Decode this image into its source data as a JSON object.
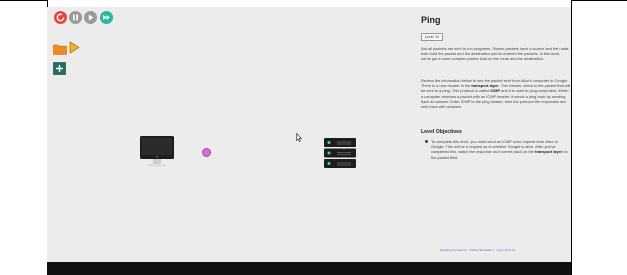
{
  "controls": [
    {
      "name": "restart",
      "color": "#e8453c"
    },
    {
      "name": "pause",
      "color": "#9a9a9a"
    },
    {
      "name": "play",
      "color": "#9a9a9a"
    },
    {
      "name": "fast-forward",
      "color": "#2db5a3"
    }
  ],
  "panel": {
    "title": "Ping",
    "level_select": "Level 10",
    "paragraph1": "Not all packets are sent to run programs. Shown packets have a source and the route: both hold the packet and the destination you've entered the packets. In this level, we've got a more complex packet hold on the route and the destination.",
    "paragraph2_pre": "Review the information below to see the packet sent from Alice's computer to Google. There is a new header in the ",
    "paragraph2_bold1": "transport layer",
    "paragraph2_mid": ". This header, which is the packet that will be sent to a ping. This protocol is called ",
    "paragraph2_bold2": "ICMP",
    "paragraph2_post": " and it is used to ping computers. When a computer receives a packet with an ICMP header, it sends a ping back by sending back an answer. Enter ICMP to the ping header, then the protocol the responses are sent back with answers.",
    "objectives_heading": "Level Objectives",
    "objective1_pre": "To complete this level, you must send an ICMP echo request from Alice to Google. This will be a request as to whether Google is alive. After you've completed this, watch the response as it comes back on the ",
    "objective1_bold": "transport layer",
    "objective1_post": " on the packet field."
  },
  "footer_text": "Hacking the Internet · Packet Simulation · Level 10 of 24"
}
